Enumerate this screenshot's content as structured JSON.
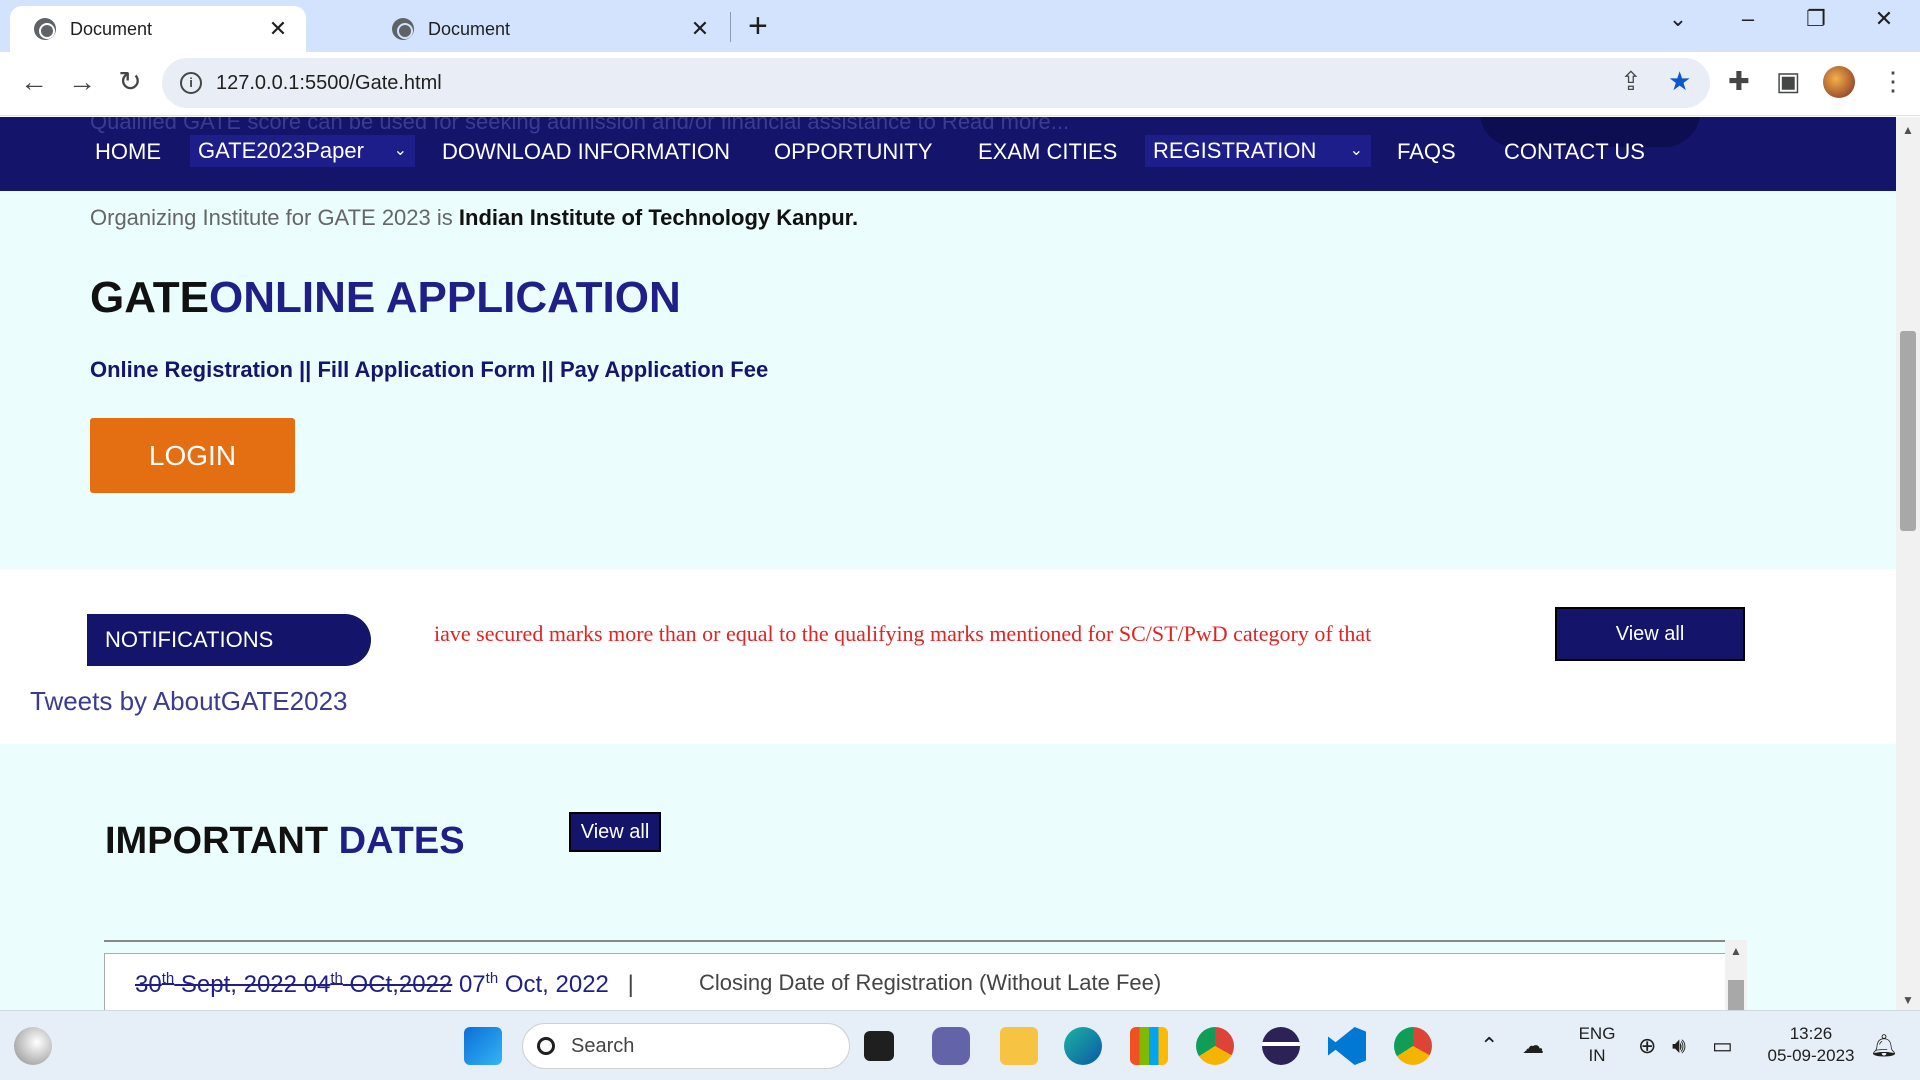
{
  "browser": {
    "tabs": [
      {
        "title": "Document",
        "active": true
      },
      {
        "title": "Document",
        "active": false
      }
    ],
    "new_tab": "+",
    "url": "127.0.0.1:5500/Gate.html"
  },
  "navbar": {
    "ghost_text": "Qualified GATE score can be used for seeking admission and/or financial assistance to Read more...",
    "items": {
      "home": "HOME",
      "paper": "GATE2023Paper",
      "download": "DOWNLOAD INFORMATION",
      "opportunity": "OPPORTUNITY",
      "exam_cities": "EXAM CITIES",
      "registration": "REGISTRATION",
      "faqs": "FAQS",
      "contact": "CONTACT US"
    }
  },
  "hero": {
    "org_prefix": "Organizing Institute for GATE 2023 is",
    "org_name": "Indian Institute of Technology Kanpur.",
    "title_black": "GATE",
    "title_blue": "ONLINE APPLICATION",
    "subtitle": "Online Registration || Fill Application Form || Pay Application Fee",
    "login": "LOGIN"
  },
  "notifications": {
    "label": "NOTIFICATIONS",
    "marquee": "iave secured marks more than or equal to the qualifying marks mentioned for SC/ST/PwD category of that",
    "view_all": "View all",
    "tweets": "Tweets by AboutGATE2023"
  },
  "important_dates": {
    "title_black": "IMPORTANT",
    "title_blue": "DATES",
    "view_all": "View all",
    "rows": [
      {
        "struck_1_day": "30",
        "struck_1_sup": "th",
        "struck_1_rest": " Sept, 2022  04",
        "struck_2_sup": "th",
        "struck_2_rest": " OCt,2022",
        "current_day": " 07",
        "current_sup": "th",
        "current_rest": " Oct, 2022",
        "separator": "|",
        "description": "Closing Date of Registration (Without Late Fee)"
      }
    ]
  },
  "taskbar": {
    "search": "Search",
    "lang_1": "ENG",
    "lang_2": "IN",
    "time": "13:26",
    "date": "05-09-2023"
  },
  "colors": {
    "navy": "#14146b",
    "accent_blue": "#1f1f87",
    "login_orange": "#e36f12",
    "page_bg": "#ebfdfd",
    "marquee_red": "#e02424"
  }
}
